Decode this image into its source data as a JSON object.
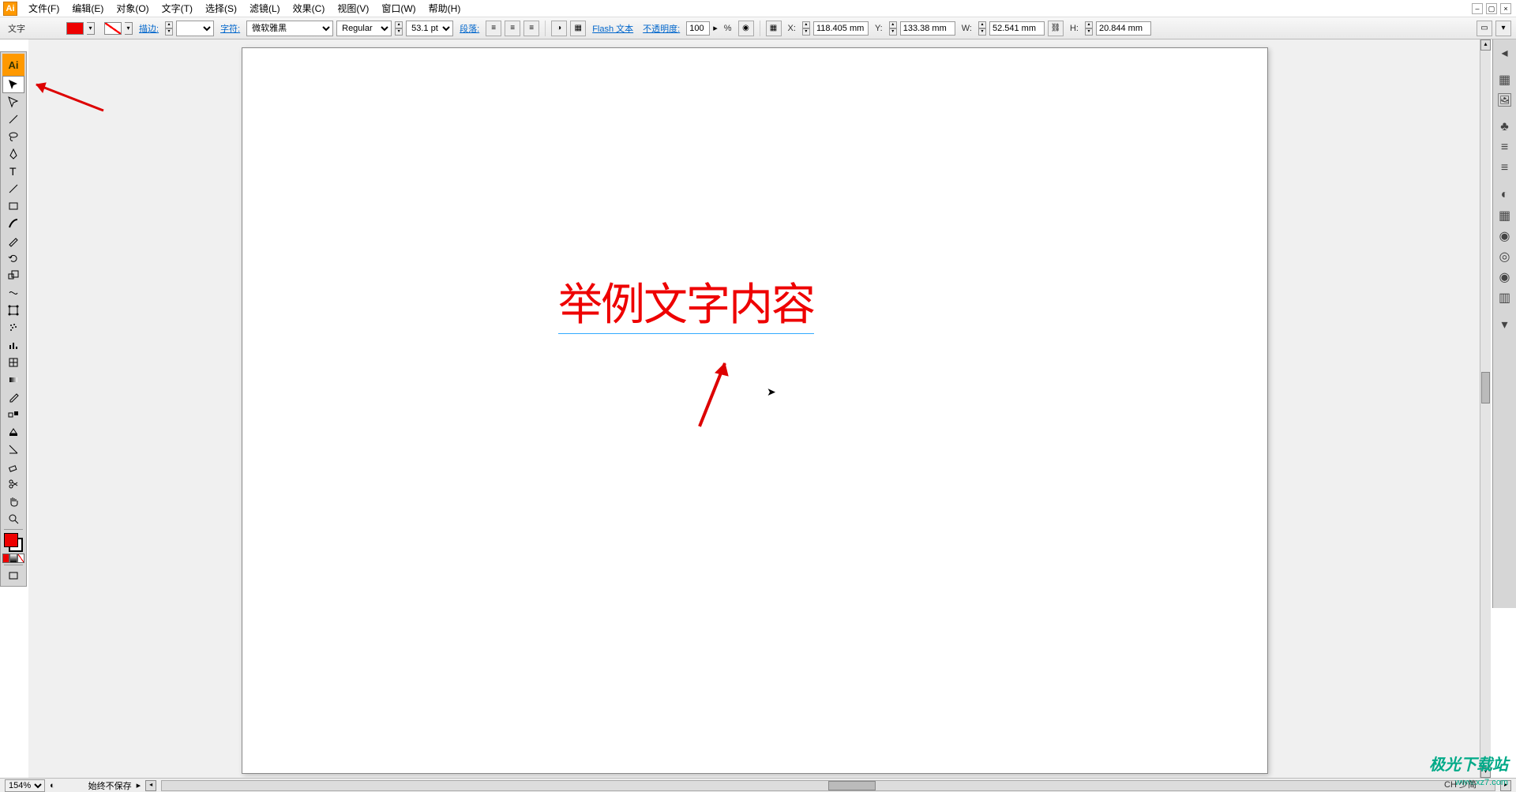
{
  "menubar": {
    "items": [
      "文件(F)",
      "编辑(E)",
      "对象(O)",
      "文字(T)",
      "选择(S)",
      "滤镜(L)",
      "效果(C)",
      "视图(V)",
      "窗口(W)",
      "帮助(H)"
    ]
  },
  "controlbar": {
    "object_type": "文字",
    "stroke_label": "描边:",
    "stroke_value": "",
    "char_label": "字符:",
    "font_family": "微软雅黑",
    "font_style": "Regular",
    "font_size": "53.1 pt",
    "paragraph_label": "段落:",
    "flash_label": "Flash 文本",
    "opacity_label": "不透明度:",
    "opacity_value": "100",
    "opacity_unit": "%",
    "x_label": "X:",
    "x_value": "118.405 mm",
    "y_label": "Y:",
    "y_value": "133.38 mm",
    "w_label": "W:",
    "w_value": "52.541 mm",
    "h_label": "H:",
    "h_value": "20.844 mm"
  },
  "canvas": {
    "sample_text": "举例文字内容"
  },
  "statusbar": {
    "zoom": "154%",
    "save_status": "始终不保存"
  },
  "watermark": {
    "title": "极光下载站",
    "url": "www.xz7.com"
  },
  "ime": "CH 少简"
}
